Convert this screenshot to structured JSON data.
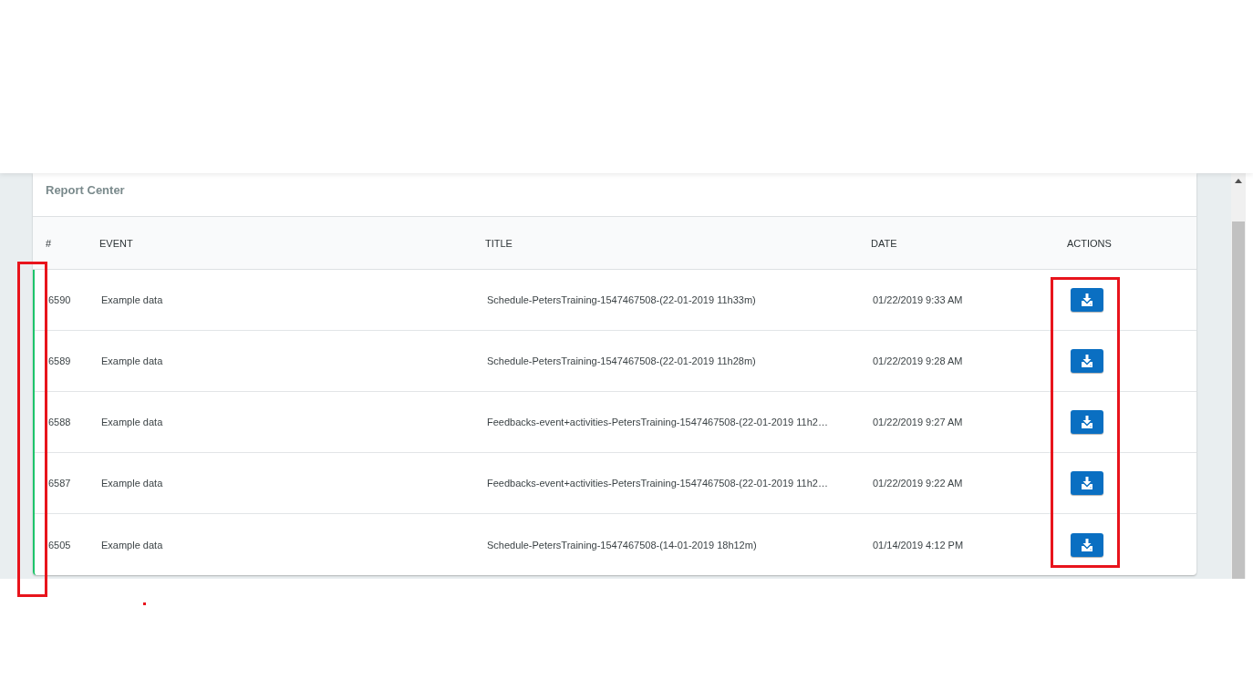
{
  "card": {
    "title": "Report Center"
  },
  "table": {
    "columns": [
      "#",
      "EVENT",
      "TITLE",
      "DATE",
      "ACTIONS"
    ],
    "rows": [
      {
        "number": "6590",
        "event": "Example data",
        "title": "Schedule-PetersTraining-1547467508-(22-01-2019 11h33m)",
        "date": "01/22/2019 9:33 AM"
      },
      {
        "number": "6589",
        "event": "Example data",
        "title": "Schedule-PetersTraining-1547467508-(22-01-2019 11h28m)",
        "date": "01/22/2019 9:28 AM"
      },
      {
        "number": "6588",
        "event": "Example data",
        "title": "Feedbacks-event+activities-PetersTraining-1547467508-(22-01-2019 11h2…",
        "date": "01/22/2019 9:27 AM"
      },
      {
        "number": "6587",
        "event": "Example data",
        "title": "Feedbacks-event+activities-PetersTraining-1547467508-(22-01-2019 11h2…",
        "date": "01/22/2019 9:22 AM"
      },
      {
        "number": "6505",
        "event": "Example data",
        "title": "Schedule-PetersTraining-1547467508-(14-01-2019 18h12m)",
        "date": "01/14/2019 4:12 PM"
      }
    ]
  }
}
